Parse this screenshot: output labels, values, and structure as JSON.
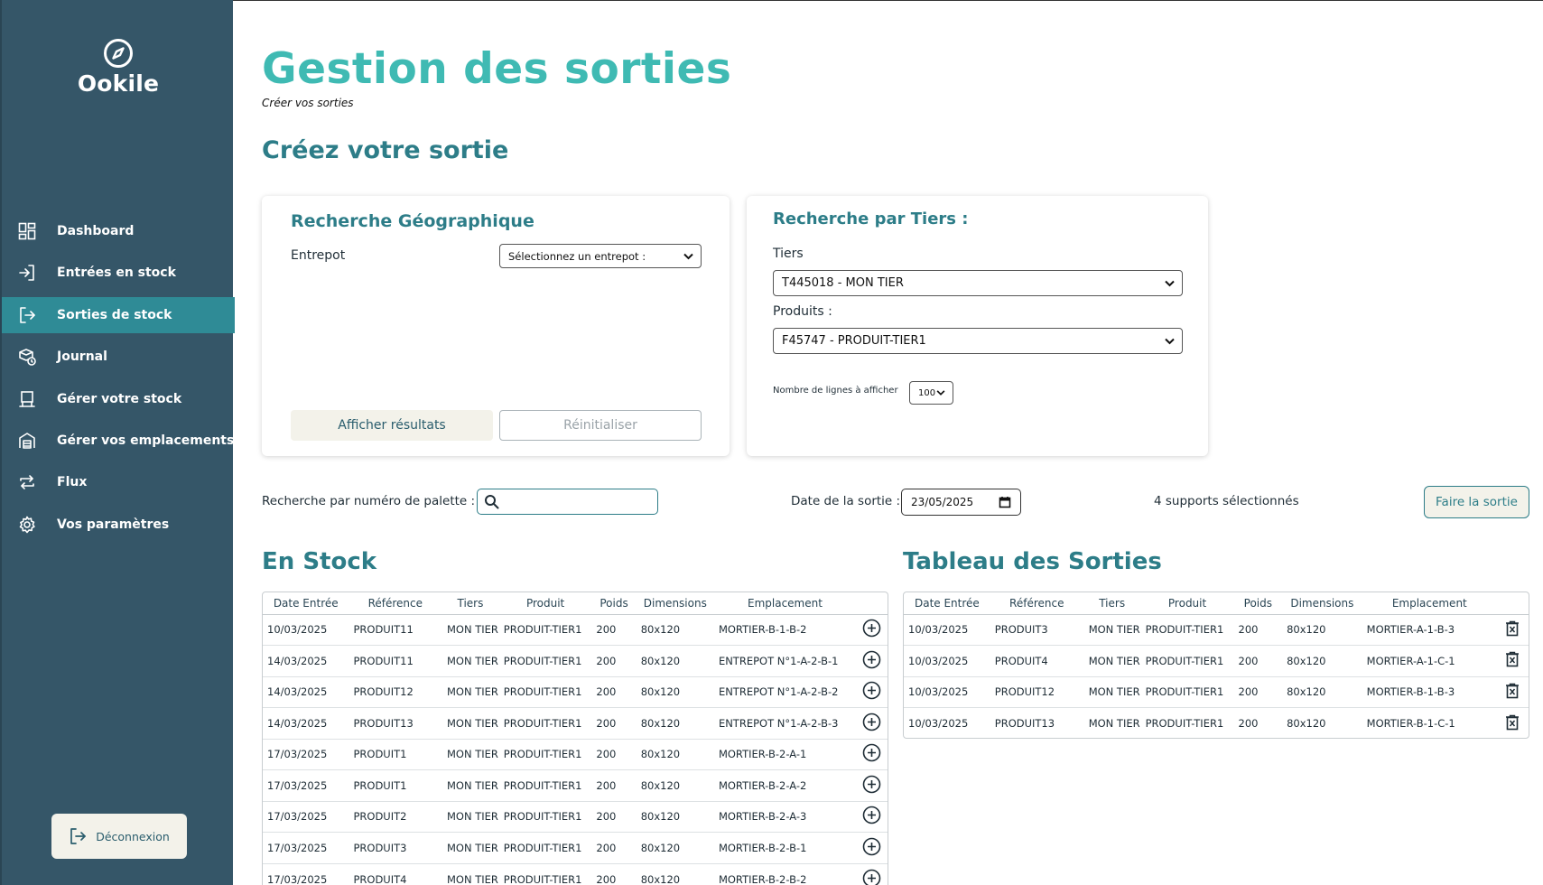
{
  "brand": {
    "name": "Ookile"
  },
  "sidebar": {
    "items": [
      {
        "label": "Dashboard",
        "icon": "dashboard-icon",
        "active": false
      },
      {
        "label": "Entrées en stock",
        "icon": "login-icon",
        "active": false
      },
      {
        "label": "Sorties de stock",
        "icon": "logout-icon",
        "active": true
      },
      {
        "label": "Journal",
        "icon": "journal-icon",
        "active": false
      },
      {
        "label": "Gérer votre stock",
        "icon": "stock-icon",
        "active": false
      },
      {
        "label": "Gérer vos emplacements",
        "icon": "warehouse-icon",
        "active": false
      },
      {
        "label": "Flux",
        "icon": "flux-icon",
        "active": false
      },
      {
        "label": "Vos paramètres",
        "icon": "gear-icon",
        "active": false
      }
    ],
    "logout_label": "Déconnexion"
  },
  "header": {
    "title": "Gestion des sorties",
    "subtitle": "Créer vos sorties",
    "section": "Créez votre sortie"
  },
  "geo": {
    "title": "Recherche Géographique",
    "entrepot_label": "Entrepot",
    "entrepot_value": "Sélectionnez un entrepot :",
    "show_results": "Afficher résultats",
    "reset": "Réinitialiser"
  },
  "tiers": {
    "title": "Recherche par Tiers :",
    "tiers_label": "Tiers",
    "tiers_value": "T445018 - MON TIER",
    "produits_label": "Produits :",
    "produits_value": "F45747 - PRODUIT-TIER1",
    "lines_label": "Nombre de lignes à afficher",
    "lines_value": "100"
  },
  "filters": {
    "palette_label": "Recherche par numéro de palette :",
    "palette_value": "",
    "date_label": "Date de la sortie :",
    "date_value": "23/05/2025",
    "selected_count": "4 supports sélectionnés",
    "submit": "Faire la sortie"
  },
  "stock_table": {
    "title": "En Stock",
    "columns": [
      "Date Entrée",
      "Référence",
      "Tiers",
      "Produit",
      "Poids",
      "Dimensions",
      "Emplacement"
    ],
    "rows": [
      [
        "10/03/2025",
        "PRODUIT11",
        "MON TIER",
        "PRODUIT-TIER1",
        "200",
        "80x120",
        "MORTIER-B-1-B-2"
      ],
      [
        "14/03/2025",
        "PRODUIT11",
        "MON TIER",
        "PRODUIT-TIER1",
        "200",
        "80x120",
        "ENTREPOT N°1-A-2-B-1"
      ],
      [
        "14/03/2025",
        "PRODUIT12",
        "MON TIER",
        "PRODUIT-TIER1",
        "200",
        "80x120",
        "ENTREPOT N°1-A-2-B-2"
      ],
      [
        "14/03/2025",
        "PRODUIT13",
        "MON TIER",
        "PRODUIT-TIER1",
        "200",
        "80x120",
        "ENTREPOT N°1-A-2-B-3"
      ],
      [
        "17/03/2025",
        "PRODUIT1",
        "MON TIER",
        "PRODUIT-TIER1",
        "200",
        "80x120",
        "MORTIER-B-2-A-1"
      ],
      [
        "17/03/2025",
        "PRODUIT1",
        "MON TIER",
        "PRODUIT-TIER1",
        "200",
        "80x120",
        "MORTIER-B-2-A-2"
      ],
      [
        "17/03/2025",
        "PRODUIT2",
        "MON TIER",
        "PRODUIT-TIER1",
        "200",
        "80x120",
        "MORTIER-B-2-A-3"
      ],
      [
        "17/03/2025",
        "PRODUIT3",
        "MON TIER",
        "PRODUIT-TIER1",
        "200",
        "80x120",
        "MORTIER-B-2-B-1"
      ],
      [
        "17/03/2025",
        "PRODUIT4",
        "MON TIER",
        "PRODUIT-TIER1",
        "200",
        "80x120",
        "MORTIER-B-2-B-2"
      ]
    ]
  },
  "sorties_table": {
    "title": "Tableau des Sorties",
    "columns": [
      "Date Entrée",
      "Référence",
      "Tiers",
      "Produit",
      "Poids",
      "Dimensions",
      "Emplacement"
    ],
    "rows": [
      [
        "10/03/2025",
        "PRODUIT3",
        "MON TIER",
        "PRODUIT-TIER1",
        "200",
        "80x120",
        "MORTIER-A-1-B-3"
      ],
      [
        "10/03/2025",
        "PRODUIT4",
        "MON TIER",
        "PRODUIT-TIER1",
        "200",
        "80x120",
        "MORTIER-A-1-C-1"
      ],
      [
        "10/03/2025",
        "PRODUIT12",
        "MON TIER",
        "PRODUIT-TIER1",
        "200",
        "80x120",
        "MORTIER-B-1-B-3"
      ],
      [
        "10/03/2025",
        "PRODUIT13",
        "MON TIER",
        "PRODUIT-TIER1",
        "200",
        "80x120",
        "MORTIER-B-1-C-1"
      ]
    ]
  },
  "colors": {
    "sidebar": "#355668",
    "active": "#2f8b96",
    "accent": "#3fbab3",
    "heading": "#2d7d88"
  }
}
